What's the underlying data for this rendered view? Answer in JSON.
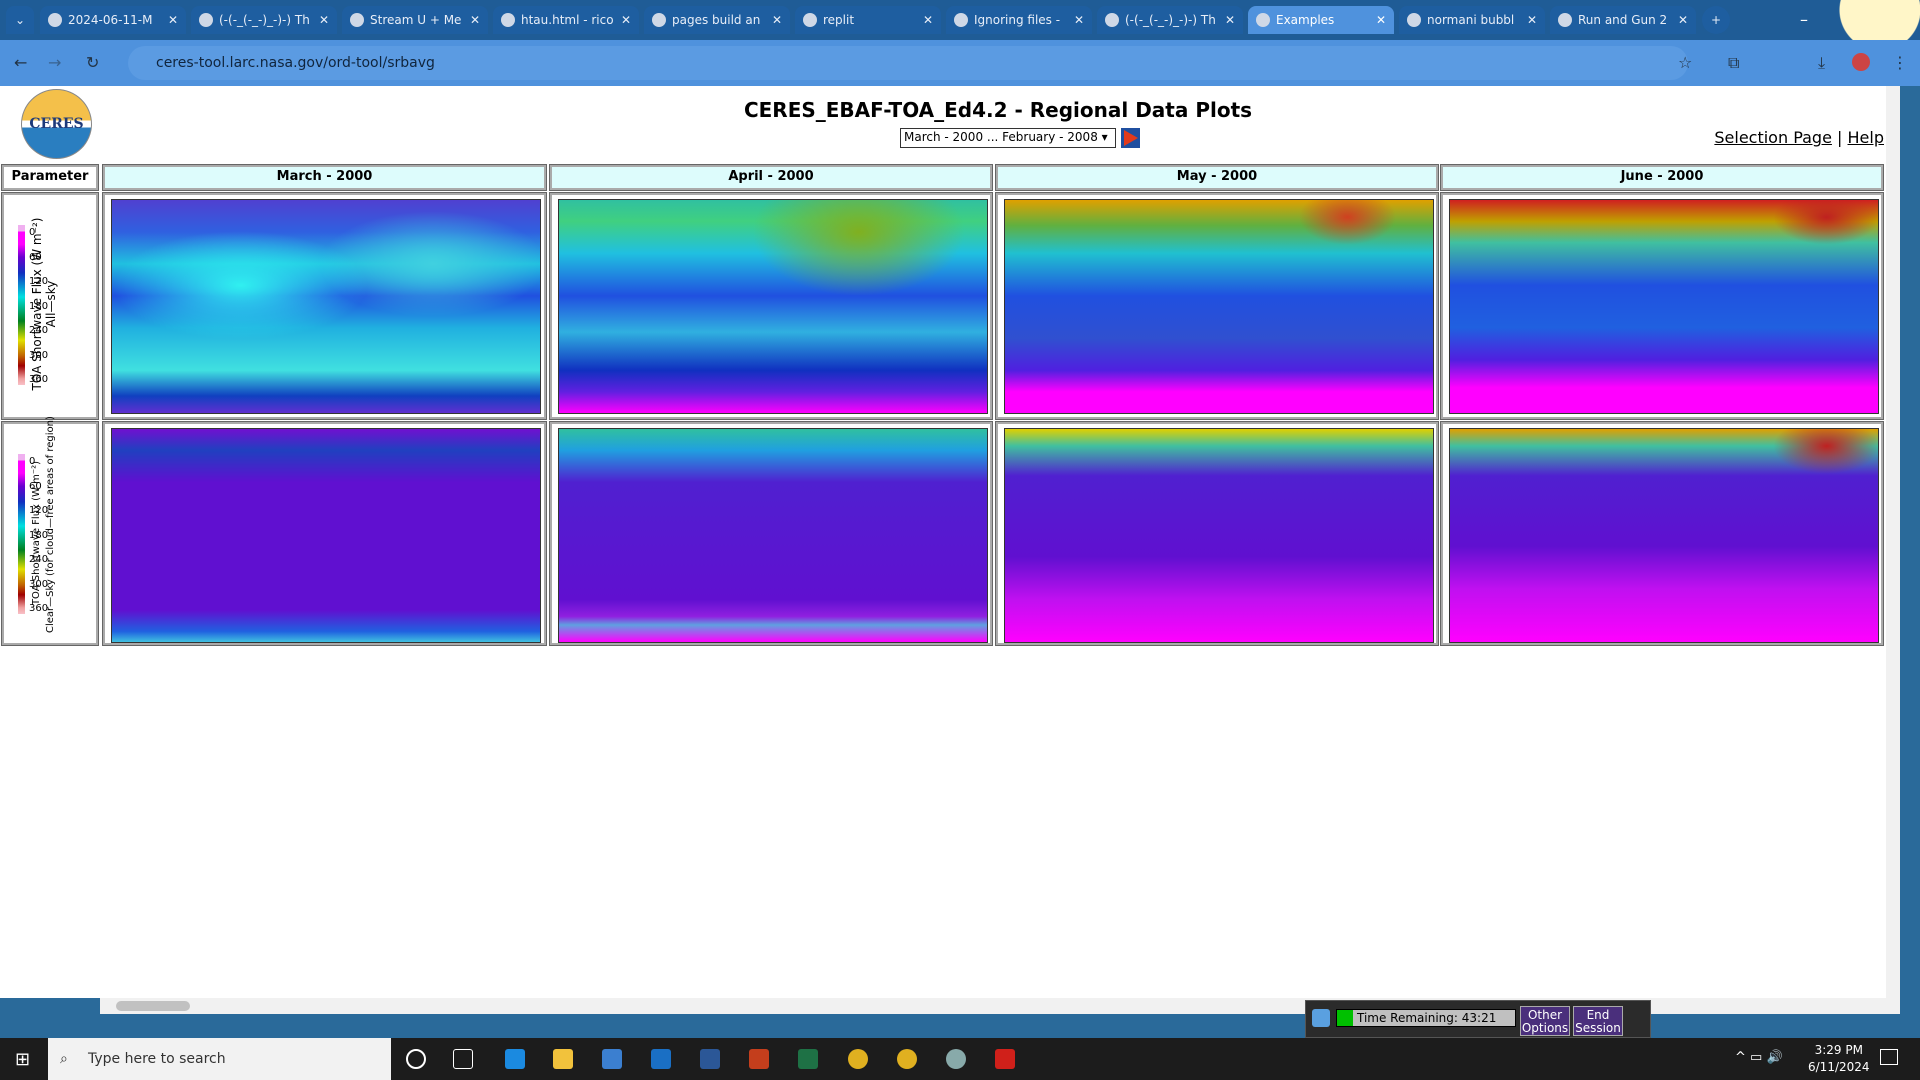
{
  "browser": {
    "tabs": [
      {
        "title": "2024-06-11-M",
        "icon": "github-icon"
      },
      {
        "title": "(-(-_(-_-)_-)-) Th",
        "icon": "globe-icon"
      },
      {
        "title": "Stream U + Me",
        "icon": "soundcloud-icon"
      },
      {
        "title": "htau.html - rico",
        "icon": "github-icon"
      },
      {
        "title": "pages build an",
        "icon": "github-icon"
      },
      {
        "title": "replit",
        "icon": "globe-icon"
      },
      {
        "title": "Ignoring files -",
        "icon": "github-icon"
      },
      {
        "title": "(-(-_(-_-)_-)-) Th",
        "icon": "globe-icon"
      },
      {
        "title": "Examples",
        "icon": "globe-icon",
        "active": true
      },
      {
        "title": "normani bubbl",
        "icon": "google-icon"
      },
      {
        "title": "Run and Gun 2",
        "icon": "trash-icon"
      }
    ],
    "url": "ceres-tool.larc.nasa.gov/ord-tool/srbavg"
  },
  "page": {
    "logo_text": "CERES",
    "title": "CERES_EBAF-TOA_Ed4.2 - Regional Data Plots",
    "range_select": "March - 2000 ... February - 2008",
    "links": {
      "selection": "Selection Page",
      "sep": "|",
      "help": "Help"
    },
    "table": {
      "param_header": "Parameter",
      "months": [
        "March - 2000",
        "April - 2000",
        "May - 2000",
        "June - 2000"
      ],
      "rows": [
        {
          "label1": "TOA Shortwave Flux (W m⁻²)",
          "label2": "All—sky",
          "ticks": [
            "0",
            "60",
            "120",
            "180",
            "240",
            "300",
            "360"
          ]
        },
        {
          "label1": "TOA Shortwave Flux (W m⁻²)",
          "label2": "Clear—Sky (for cloud—free areas of region)",
          "ticks": [
            "0",
            "60",
            "120",
            "180",
            "240",
            "300",
            "360"
          ]
        }
      ]
    }
  },
  "session": {
    "time_remaining": "Time Remaining: 43:21",
    "other_options": "Other Options",
    "end_session": "End Session"
  },
  "taskbar": {
    "search_placeholder": "Type here to search",
    "time": "3:29 PM",
    "date": "6/11/2024"
  }
}
